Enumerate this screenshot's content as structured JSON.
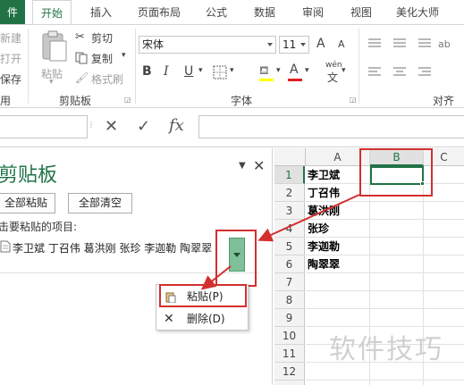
{
  "tabs": [
    "件",
    "开始",
    "插入",
    "页面布局",
    "公式",
    "数据",
    "审阅",
    "视图",
    "美化大师"
  ],
  "ribbon": {
    "cut": "剪切",
    "copy": "复制",
    "format_painter": "格式刷",
    "paste": "粘贴",
    "clipboard_group": "剪贴板",
    "left_cut_items": [
      "新建",
      "打开",
      "保存",
      "用"
    ],
    "font_name": "宋体",
    "font_size": "11",
    "bold": "B",
    "italic": "I",
    "underline": "U",
    "grow_font": "A",
    "shrink_font": "A",
    "font_color_letter": "A",
    "wen": "wén",
    "font_group": "字体",
    "align_group": "对齐方"
  },
  "formula_bar": {
    "cancel": "✕",
    "enter": "✓",
    "fx": "fx"
  },
  "pane": {
    "title": "剪贴板",
    "paste_all": "全部粘贴",
    "clear_all": "全部清空",
    "prompt": "击要粘贴的项目:",
    "item_text": "李卫斌 丁召伟 葛洪刚 张珍 李迦勒 陶翠翠",
    "menu": [
      {
        "label": "粘贴(P)"
      },
      {
        "label": "删除(D)"
      }
    ]
  },
  "grid": {
    "columns": [
      "A",
      "B",
      "C"
    ],
    "rows": [
      "1",
      "2",
      "3",
      "4",
      "5",
      "6",
      "7",
      "8",
      "9",
      "10",
      "11",
      "12",
      "13"
    ],
    "colA": [
      "李卫斌",
      "丁召伟",
      "葛洪刚",
      "张珍",
      "李迦勒",
      "陶翠翠",
      "",
      "",
      "",
      "",
      "",
      "",
      ""
    ]
  },
  "watermark": "软件技巧",
  "colors": {
    "accent": "#217346",
    "highlight": "#d32f2f"
  }
}
